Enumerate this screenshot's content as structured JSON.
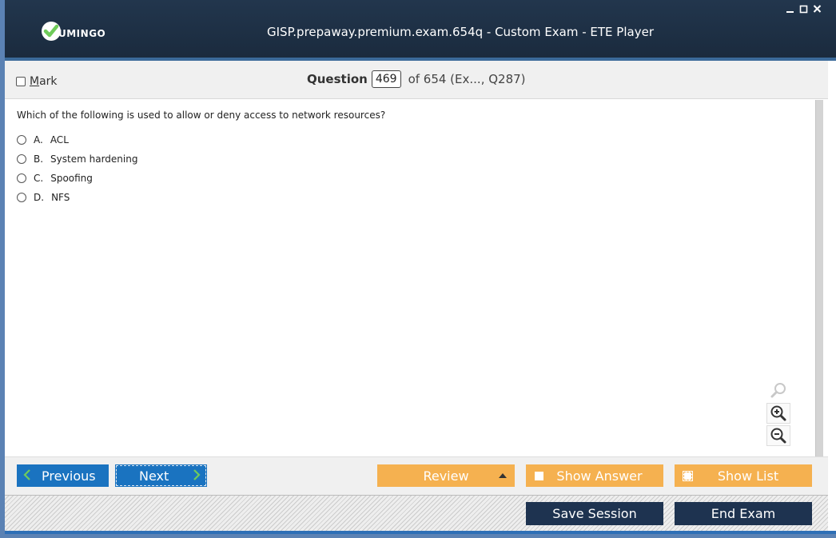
{
  "window": {
    "title": "GISP.prepaway.premium.exam.654q - Custom Exam - ETE Player",
    "logo_text": "UMINGO",
    "controls": [
      "minimize-icon",
      "maximize-icon",
      "close-icon"
    ]
  },
  "question_bar": {
    "mark_label": "Mark",
    "question_label": "Question",
    "question_number": "469",
    "of_text": "of 654 (Ex..., Q287)"
  },
  "question": {
    "text": "Which of the following is used to allow or deny access to network resources?",
    "options": [
      {
        "letter": "A.",
        "text": "ACL"
      },
      {
        "letter": "B.",
        "text": "System hardening"
      },
      {
        "letter": "C.",
        "text": "Spoofing"
      },
      {
        "letter": "D.",
        "text": "NFS"
      }
    ]
  },
  "zoom_icons": [
    "zoom-reset-icon",
    "zoom-in-icon",
    "zoom-out-icon"
  ],
  "buttons": {
    "previous": "Previous",
    "next": "Next",
    "review": "Review",
    "show_answer": "Show Answer",
    "show_list": "Show List",
    "save_session": "Save Session",
    "end_exam": "End Exam"
  },
  "colors": {
    "title_bar": "#1a2a3d",
    "nav_blue": "#1a73c0",
    "orange": "#f5b150",
    "dark_button": "#1e3350",
    "check_green": "#6fcb5a"
  }
}
